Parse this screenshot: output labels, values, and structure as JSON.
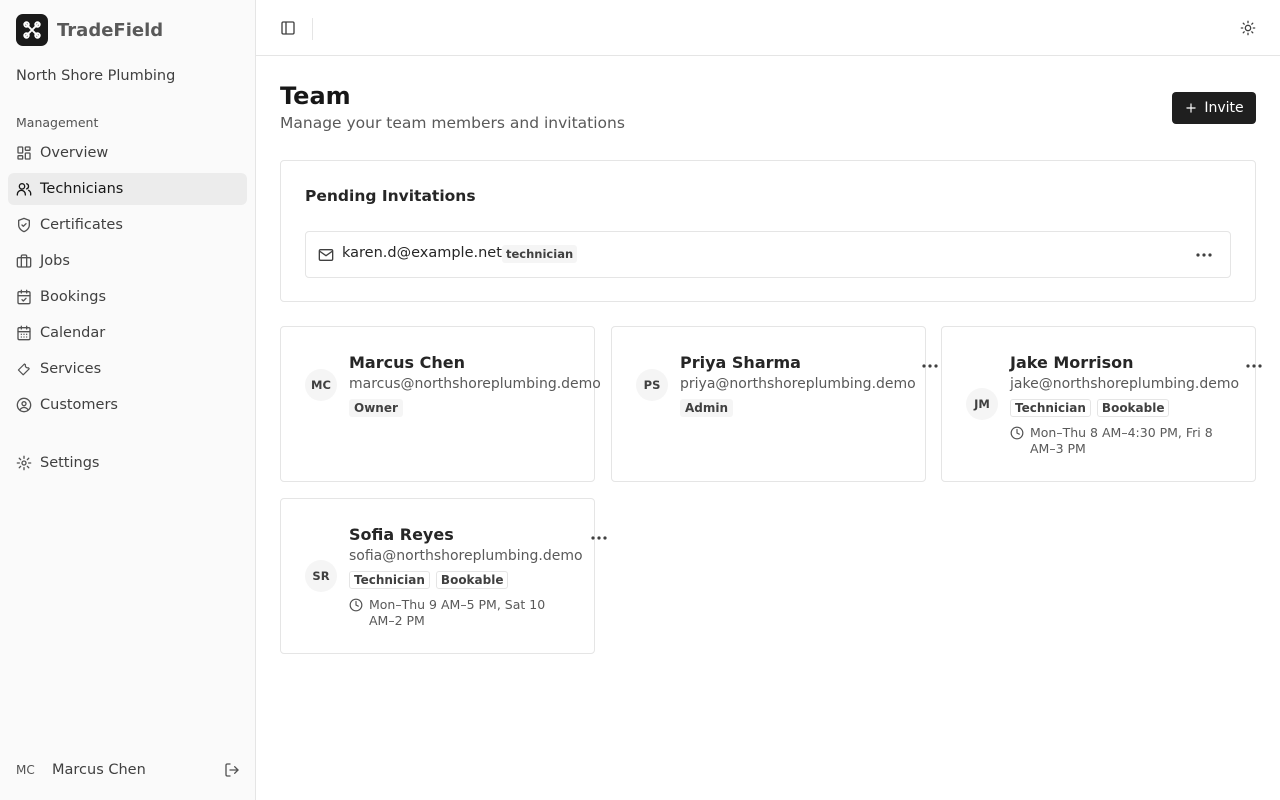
{
  "app": {
    "name": "TradeField",
    "organization": "North Shore Plumbing"
  },
  "sidebar": {
    "section_label": "Management",
    "items": [
      {
        "label": "Overview",
        "icon": "dashboard-icon"
      },
      {
        "label": "Technicians",
        "icon": "users-icon",
        "active": true
      },
      {
        "label": "Certificates",
        "icon": "shield-check-icon"
      },
      {
        "label": "Jobs",
        "icon": "briefcase-icon"
      },
      {
        "label": "Bookings",
        "icon": "calendar-check-icon"
      },
      {
        "label": "Calendar",
        "icon": "calendar-icon"
      },
      {
        "label": "Services",
        "icon": "wrench-icon"
      },
      {
        "label": "Customers",
        "icon": "user-circle-icon"
      }
    ],
    "settings_label": "Settings",
    "user": {
      "initials": "MC",
      "name": "Marcus Chen"
    }
  },
  "page": {
    "title": "Team",
    "subtitle": "Manage your team members and invitations",
    "invite_label": "Invite"
  },
  "pending": {
    "title": "Pending Invitations",
    "invitations": [
      {
        "email": "karen.d@example.net",
        "role": "technician"
      }
    ]
  },
  "members": [
    {
      "initials": "MC",
      "name": "Marcus Chen",
      "email": "marcus@northshoreplumbing.demo",
      "badges": [
        "Owner"
      ]
    },
    {
      "initials": "PS",
      "name": "Priya Sharma",
      "email": "priya@northshoreplumbing.demo",
      "badges": [
        "Admin"
      ]
    },
    {
      "initials": "JM",
      "name": "Jake Morrison",
      "email": "jake@northshoreplumbing.demo",
      "badges": [
        "Technician",
        "Bookable"
      ],
      "hours": "Mon–Thu 8 AM–4:30 PM, Fri 8 AM–3 PM"
    },
    {
      "initials": "SR",
      "name": "Sofia Reyes",
      "email": "sofia@northshoreplumbing.demo",
      "badges": [
        "Technician",
        "Bookable"
      ],
      "hours": "Mon–Thu 9 AM–5 PM, Sat 10 AM–2 PM"
    }
  ]
}
